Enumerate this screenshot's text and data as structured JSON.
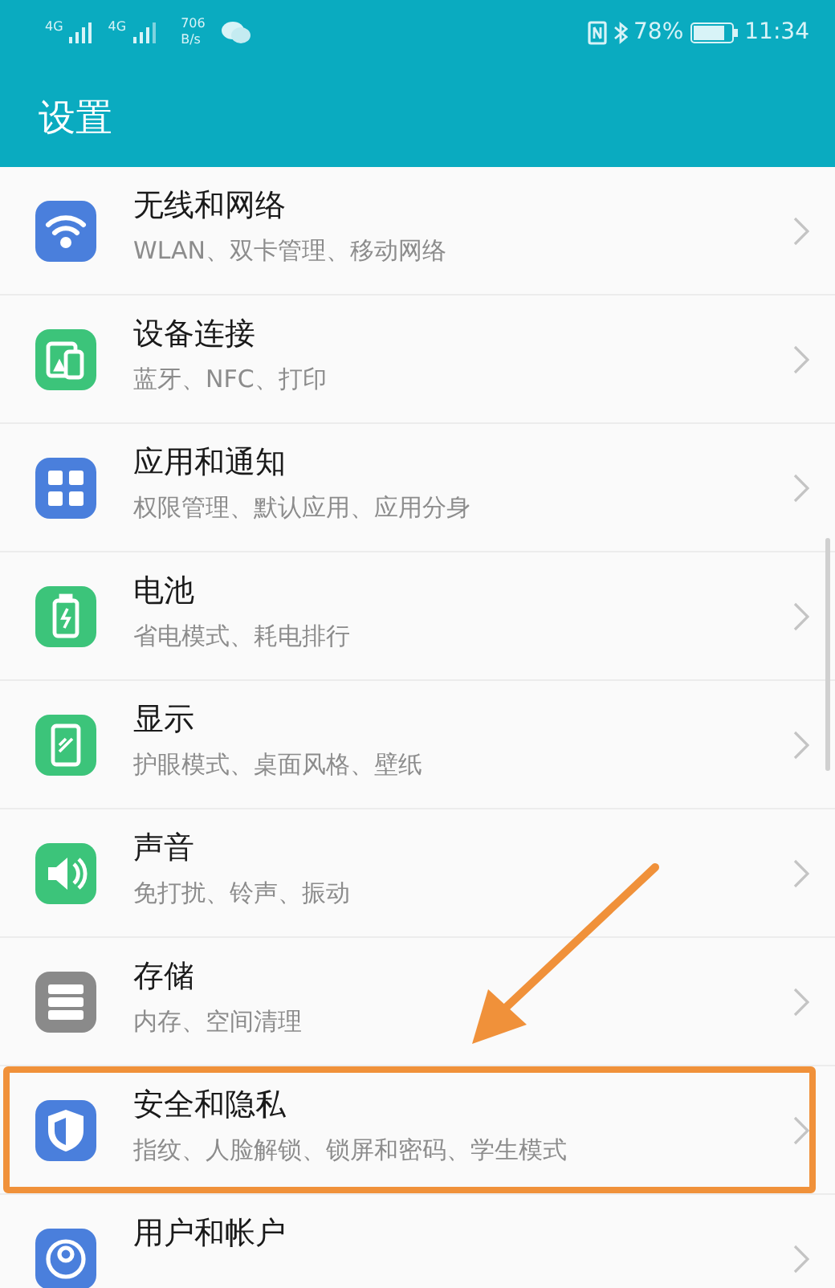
{
  "status_bar": {
    "sim_1": "4G",
    "sim_2": "4G",
    "speed_value": "706",
    "speed_unit": "B/s",
    "battery_percent": "78%",
    "time": "11:34"
  },
  "header": {
    "title": "设置"
  },
  "items": [
    {
      "kind": "wifi",
      "color": "#4a7fdc",
      "title": "无线和网络",
      "subtitle": "WLAN、双卡管理、移动网络",
      "highlighted": false
    },
    {
      "kind": "devices",
      "color": "#3cc47a",
      "title": "设备连接",
      "subtitle": "蓝牙、NFC、打印",
      "highlighted": false
    },
    {
      "kind": "apps",
      "color": "#4a7fdc",
      "title": "应用和通知",
      "subtitle": "权限管理、默认应用、应用分身",
      "highlighted": false
    },
    {
      "kind": "battery",
      "color": "#3cc47a",
      "title": "电池",
      "subtitle": "省电模式、耗电排行",
      "highlighted": false
    },
    {
      "kind": "display",
      "color": "#3cc47a",
      "title": "显示",
      "subtitle": "护眼模式、桌面风格、壁纸",
      "highlighted": false
    },
    {
      "kind": "sound",
      "color": "#3cc47a",
      "title": "声音",
      "subtitle": "免打扰、铃声、振动",
      "highlighted": false
    },
    {
      "kind": "storage",
      "color": "#8a8a8a",
      "title": "存储",
      "subtitle": "内存、空间清理",
      "highlighted": false
    },
    {
      "kind": "shield",
      "color": "#4a7fdc",
      "title": "安全和隐私",
      "subtitle": "指纹、人脸解锁、锁屏和密码、学生模式",
      "highlighted": true
    },
    {
      "kind": "user",
      "color": "#4a7fdc",
      "title": "用户和帐户",
      "highlighted": false
    }
  ]
}
